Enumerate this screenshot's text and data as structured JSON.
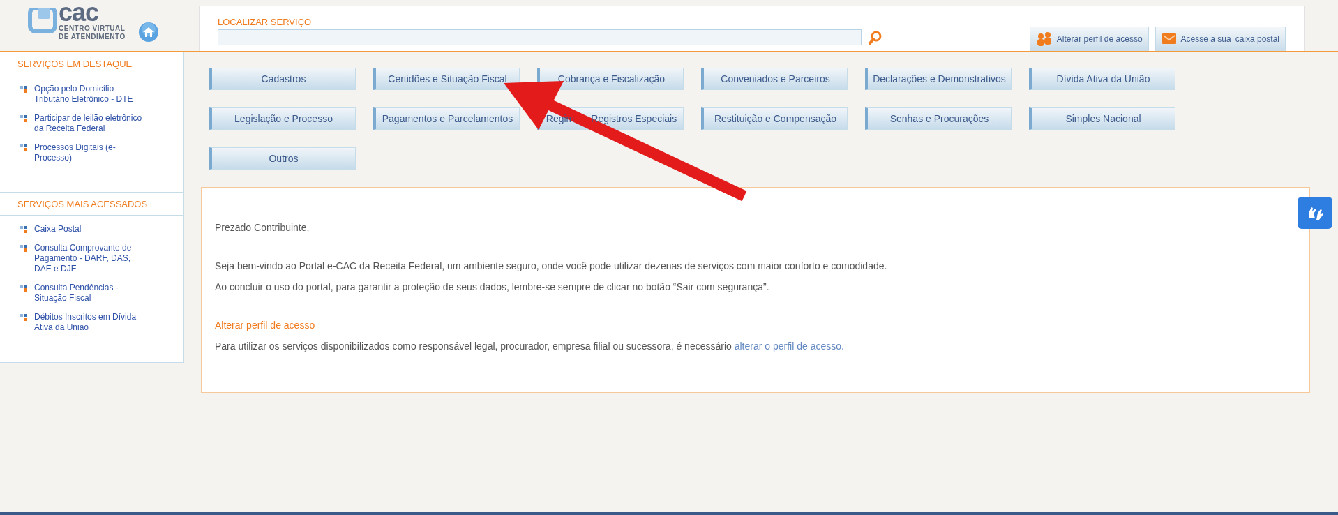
{
  "logo": {
    "mark": "cac",
    "lines": [
      "CENTRO VIRTUAL",
      "DE ATENDIMENTO"
    ]
  },
  "search": {
    "label": "LOCALIZAR SERVIÇO"
  },
  "header_buttons": [
    {
      "kind": "profile",
      "label": "Alterar perfil de acesso"
    },
    {
      "kind": "mail",
      "label": "Acesse a sua",
      "link": "caixa postal"
    }
  ],
  "sidebar": [
    {
      "title": "SERVIÇOS EM DESTAQUE",
      "items": [
        "Opção pelo Domicílio Tributário Eletrônico - DTE",
        "Participar de leilão eletrônico da Receita Federal",
        "Processos Digitais (e-Processo)"
      ]
    },
    {
      "title": "SERVIÇOS MAIS ACESSADOS",
      "items": [
        "Caixa Postal",
        "Consulta Comprovante de Pagamento - DARF, DAS, DAE e DJE",
        "Consulta Pendências - Situação Fiscal",
        "Débitos Inscritos em Dívida Ativa da União"
      ]
    }
  ],
  "categories": [
    "Cadastros",
    "Certidões e Situação Fiscal",
    "Cobrança e Fiscalização",
    "Conveniados e Parceiros",
    "Declarações e Demonstrativos",
    "Dívida Ativa da União",
    "Legislação e Processo",
    "Pagamentos e Parcelamentos",
    [
      "Regim",
      "Registros Especiais"
    ],
    "Restituição e Compensação",
    "Senhas e Procurações",
    "Simples Nacional",
    "Outros"
  ],
  "welcome": [
    {
      "kind": "text",
      "text": "Prezado Contribuinte,"
    },
    {
      "kind": "gap"
    },
    {
      "kind": "text",
      "text": "Seja bem-vindo ao Portal e-CAC da Receita Federal, um ambiente seguro, onde você pode utilizar dezenas de serviços com maior conforto e comodidade."
    },
    {
      "kind": "text",
      "text": "Ao concluir o uso do portal, para garantir a proteção de seus dados, lembre-se sempre de clicar no botão “Sair com segurança”."
    },
    {
      "kind": "gap"
    },
    {
      "kind": "heading",
      "text": "Alterar perfil de acesso"
    },
    {
      "kind": "text",
      "text": "Para utilizar os serviços disponibilizados como responsável legal, procurador, empresa filial ou sucessora, é necessário",
      "link": "alterar o perfil de acesso."
    }
  ]
}
